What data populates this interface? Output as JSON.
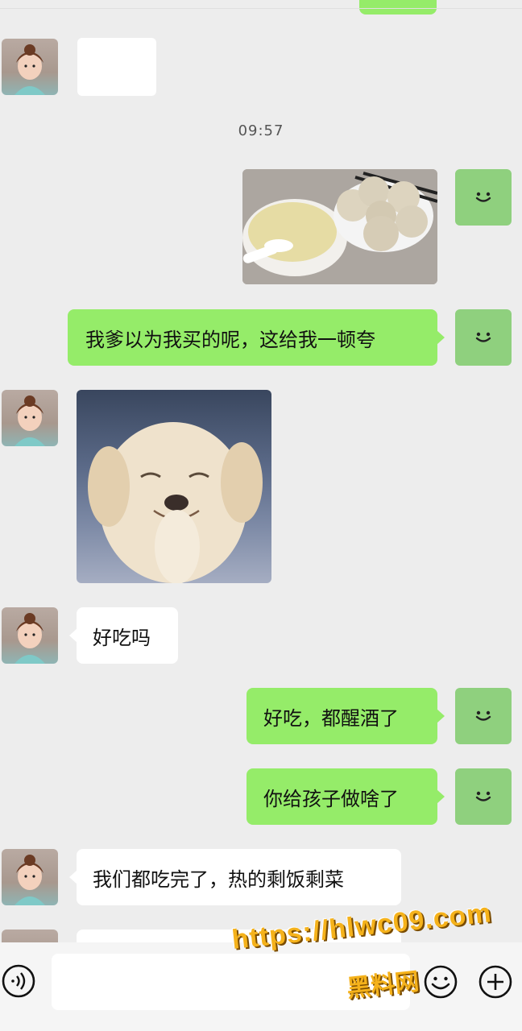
{
  "chat": {
    "timestamp": "09:57",
    "messages": [
      {
        "from": "me",
        "type": "image",
        "content": "steamed buns and porridge"
      },
      {
        "from": "me",
        "type": "text",
        "text": "我爹以为我买的呢，这给我一顿夸"
      },
      {
        "from": "other",
        "type": "sticker",
        "content": "smiling puppy"
      },
      {
        "from": "other",
        "type": "text",
        "text": "好吃吗"
      },
      {
        "from": "me",
        "type": "text",
        "text": "好吃，都醒酒了"
      },
      {
        "from": "me",
        "type": "text",
        "text": "你给孩子做啥了"
      },
      {
        "from": "other",
        "type": "text",
        "text": "我们都吃完了，热的剩饭剩菜"
      }
    ]
  },
  "input_bar": {
    "voice_icon": "voice-icon",
    "emoji_icon": "emoji-icon",
    "plus_icon": "plus-icon"
  },
  "watermark": {
    "line1": "https://hlwc09.com",
    "line2": "黑料网"
  },
  "colors": {
    "background": "#ededed",
    "me_bubble": "#95ec69",
    "other_bubble": "#ffffff"
  }
}
